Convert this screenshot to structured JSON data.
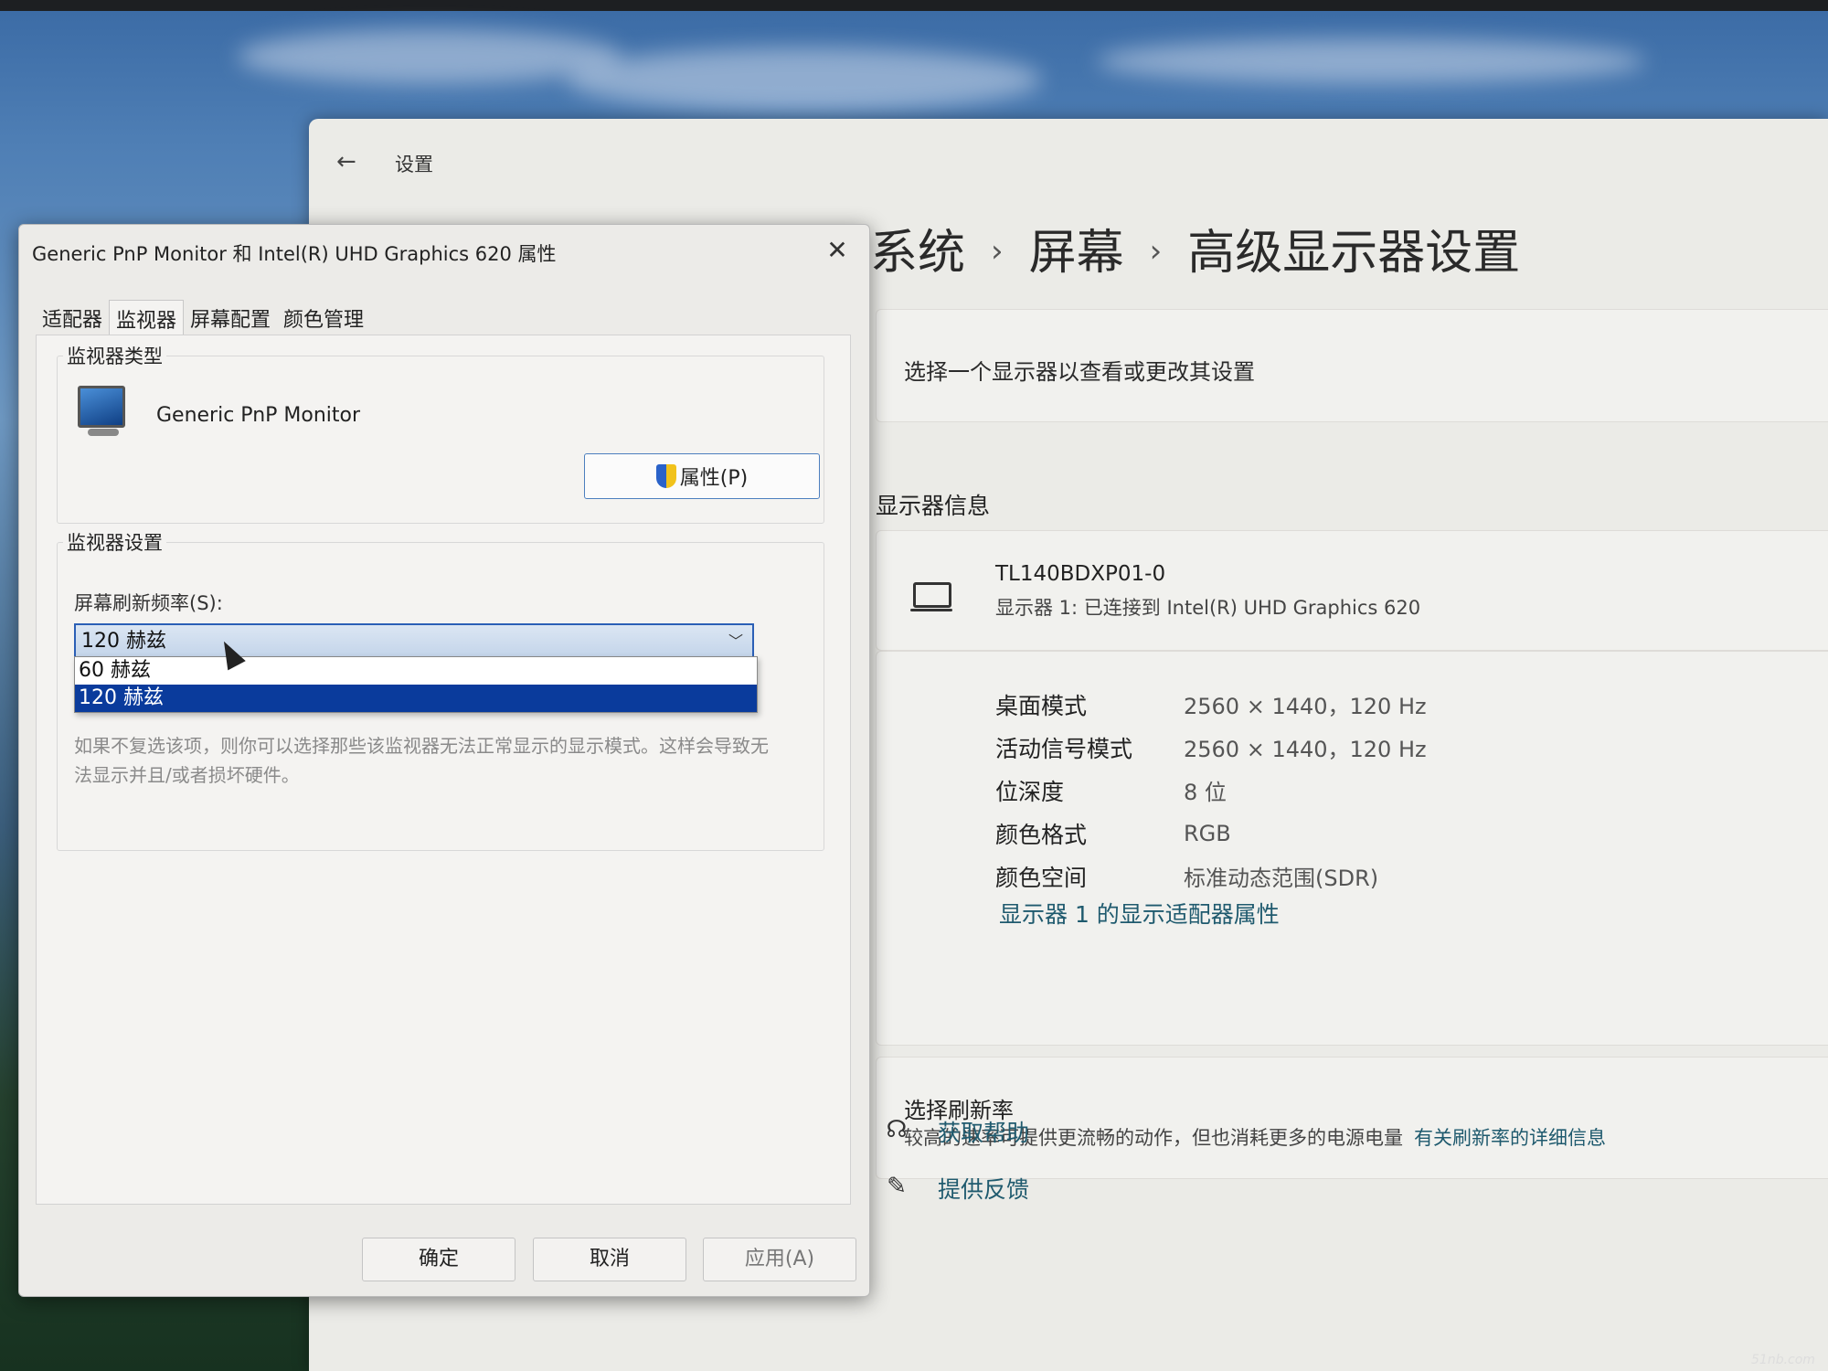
{
  "settings": {
    "window_title": "设置",
    "breadcrumb": [
      "系统",
      "屏幕",
      "高级显示器设置"
    ],
    "select_display_text": "选择一个显示器以查看或更改其设置",
    "display_info_header": "显示器信息",
    "monitor_model": "TL140BDXP01-0",
    "monitor_connection": "显示器 1: 已连接到 Intel(R) UHD Graphics 620",
    "info_rows": [
      {
        "label": "桌面模式",
        "value": "2560 × 1440，120 Hz"
      },
      {
        "label": "活动信号模式",
        "value": "2560 × 1440，120 Hz"
      },
      {
        "label": "位深度",
        "value": "8 位"
      },
      {
        "label": "颜色格式",
        "value": "RGB"
      },
      {
        "label": "颜色空间",
        "value": "标准动态范围(SDR)"
      }
    ],
    "adapter_properties_link": "显示器 1 的显示适配器属性",
    "refresh_title": "选择刷新率",
    "refresh_desc": "较高的速率可提供更流畅的动作，但也消耗更多的电源电量",
    "refresh_link": "有关刷新率的详细信息",
    "get_help": "获取帮助",
    "feedback": "提供反馈"
  },
  "dialog": {
    "title": "Generic PnP Monitor 和 Intel(R) UHD Graphics 620 属性",
    "tabs": [
      "适配器",
      "监视器",
      "屏幕配置",
      "颜色管理"
    ],
    "active_tab": "监视器",
    "monitor_type_label": "监视器类型",
    "monitor_name": "Generic PnP Monitor",
    "properties_button": "属性(P)",
    "monitor_settings_label": "监视器设置",
    "refresh_rate_label": "屏幕刷新频率(S):",
    "refresh_selected": "120 赫兹",
    "refresh_options": [
      "60 赫兹",
      "120 赫兹"
    ],
    "hint_text": "如果不复选该项，则你可以选择那些该监视器无法正常显示的显示模式。这样会导致无法显示并且/或者损坏硬件。",
    "ok_button": "确定",
    "cancel_button": "取消",
    "apply_button": "应用(A)"
  },
  "watermark": "51nb.com",
  "colors": {
    "link": "#1f5a6e",
    "selection": "#0a3b9c",
    "focus_border": "#2b5fb6"
  }
}
